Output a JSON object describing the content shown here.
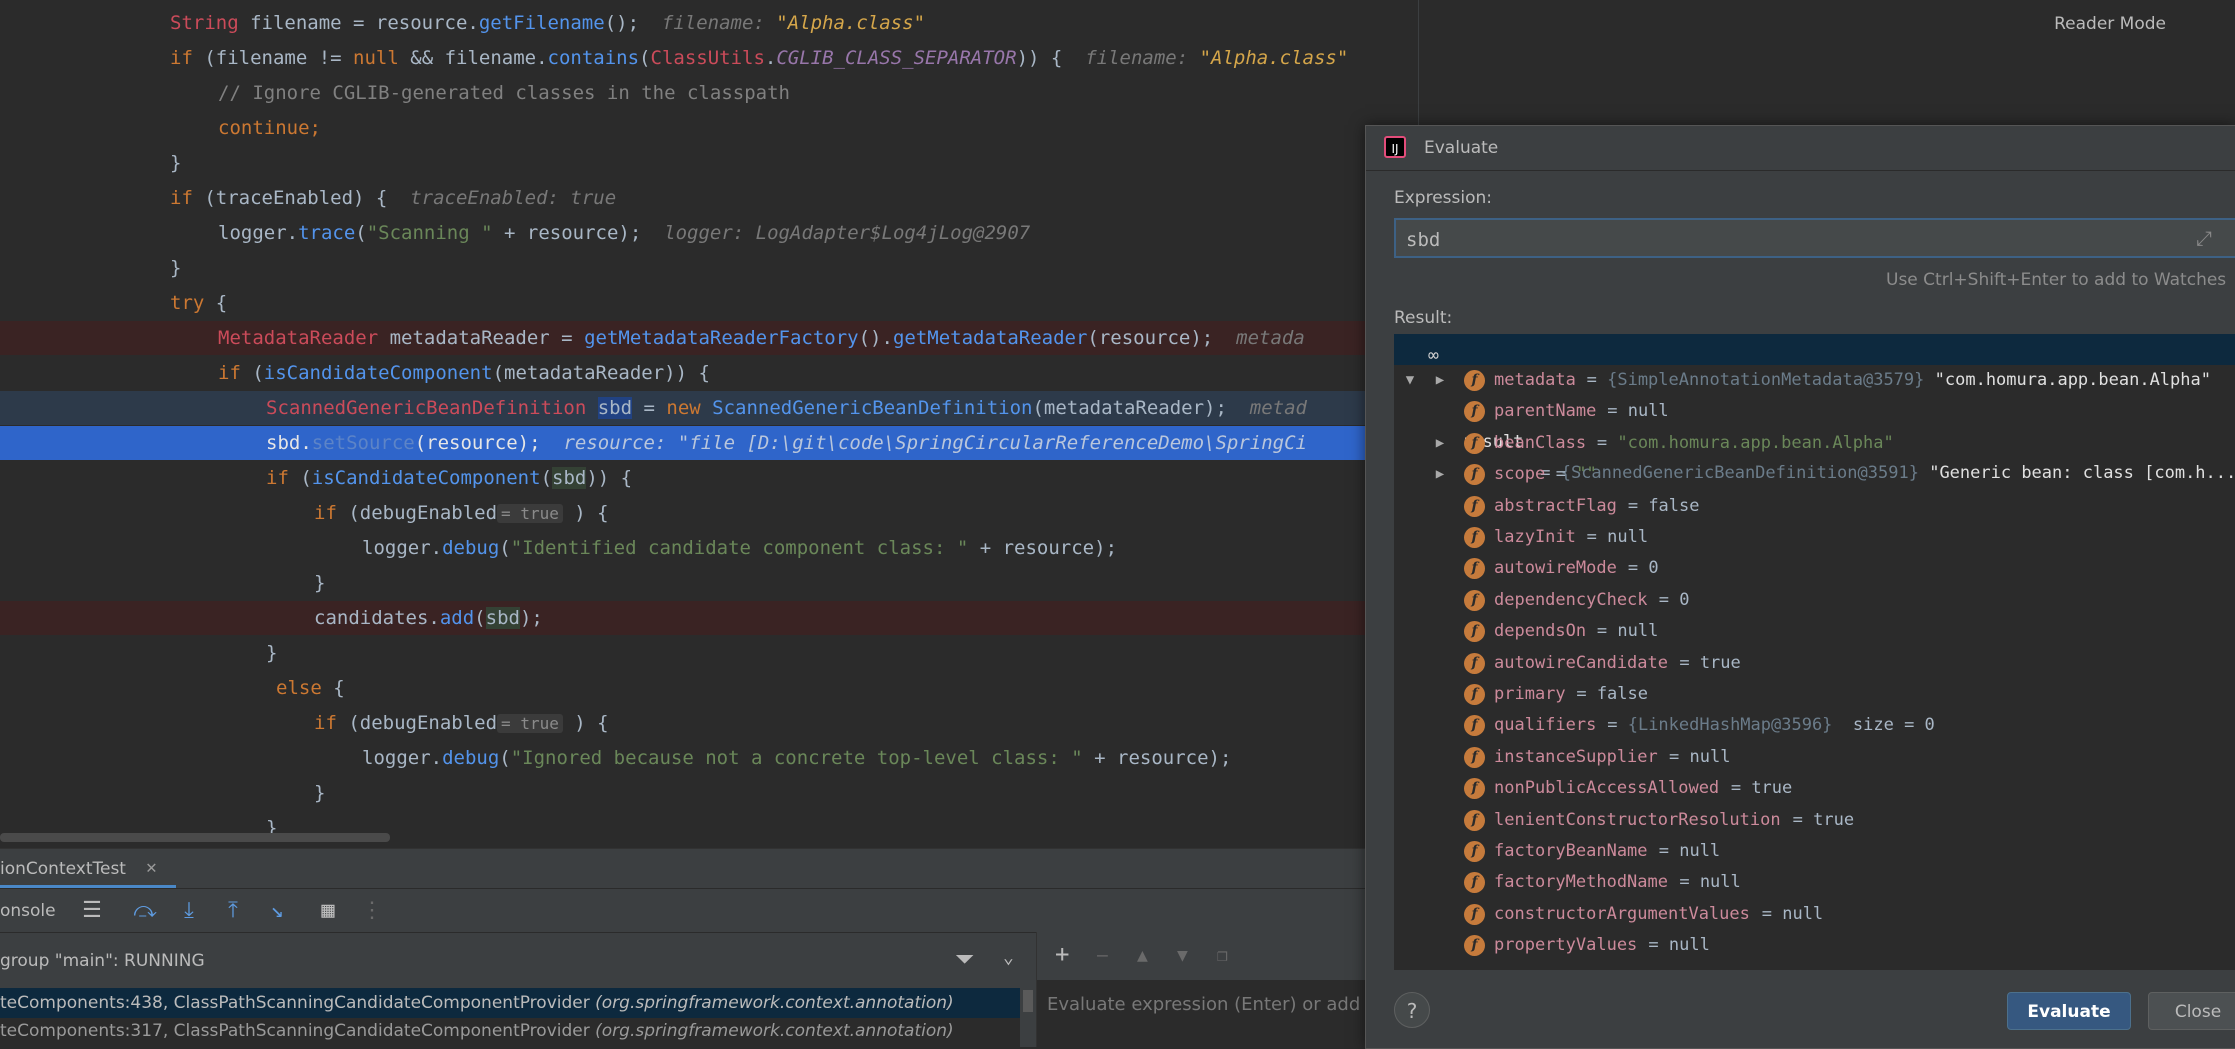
{
  "editor": {
    "lines": [
      [
        "String filename = resource.getFilename();",
        "filename: \"Alpha.class\""
      ],
      [
        "if (filename != null && filename.contains(ClassUtils.CGLIB_CLASS_SEPARATOR)) {",
        "filename: \"Alpha.class\""
      ],
      [
        "// Ignore CGLIB-generated classes in the classpath"
      ],
      [
        "continue;"
      ],
      [
        "}"
      ],
      [
        "if (traceEnabled) {",
        "traceEnabled: true"
      ],
      [
        "logger.trace(\"Scanning \" + resource);",
        "logger: LogAdapter$Log4jLog@2907"
      ],
      [
        "}"
      ],
      [
        "try {"
      ],
      [
        "MetadataReader metadataReader = getMetadataReaderFactory().getMetadataReader(resource);",
        "metada"
      ],
      [
        "if (isCandidateComponent(metadataReader)) {"
      ],
      [
        "ScannedGenericBeanDefinition sbd = new ScannedGenericBeanDefinition(metadataReader);",
        "metad"
      ],
      [
        "sbd.setSource(resource);",
        "resource: \"file [D:\\git\\code\\SpringCircularReferenceDemo\\SpringCi"
      ],
      [
        "if (isCandidateComponent(sbd)) {"
      ],
      [
        "if (debugEnabled",
        "= true",
        ") {"
      ],
      [
        "logger.debug(\"Identified candidate component class: \" + resource);"
      ],
      [
        "}"
      ],
      [
        "candidates.add(sbd);"
      ],
      [
        "}"
      ],
      [
        "else {"
      ],
      [
        "if (debugEnabled",
        "= true",
        ") {"
      ],
      [
        "logger.debug(\"Ignored because not a concrete top-level class: \" + resource);"
      ],
      [
        "}"
      ],
      [
        "}"
      ]
    ]
  },
  "top_right": {
    "reader_mode": "Reader Mode"
  },
  "debug_tab": {
    "label": "ionContextTest",
    "close": "✕"
  },
  "debug_toolbar": {
    "console_label": "onsole",
    "icons": [
      "menu-icon",
      "step-over-icon",
      "step-into-icon",
      "step-out-icon",
      "run-to-cursor-icon",
      "evaluate-icon",
      "trace-icon"
    ]
  },
  "frames": {
    "thread": "group \"main\": RUNNING",
    "rows": [
      {
        "method": "teComponents:438, ClassPathScanningCandidateComponentProvider",
        "pkg": "(org.springframework.context.annotation)",
        "active": true
      },
      {
        "method": "teComponents:317, ClassPathScanningCandidateComponentProvider",
        "pkg": "(org.springframework.context.annotation)",
        "active": false
      }
    ]
  },
  "watches": {
    "placeholder": "Evaluate expression (Enter) or add a watch"
  },
  "dialog": {
    "title": "Evaluate",
    "expression_label": "Expression:",
    "expression_value": "sbd",
    "hint": "Use Ctrl+Shift+Enter to add to Watches",
    "result_label": "Result:",
    "result": {
      "name": "result",
      "object": "{ScannedGenericBeanDefinition@3591}",
      "string": "\"Generic bean: class [com.h... V",
      "fields": [
        {
          "name": "metadata",
          "object": "{SimpleAnnotationMetadata@3579}",
          "value": "\"com.homura.app.bean.Alpha\"",
          "expandable": true
        },
        {
          "name": "parentName",
          "value": "null"
        },
        {
          "name": "beanClass",
          "value": "\"com.homura.app.bean.Alpha\"",
          "expandable": true,
          "green": true
        },
        {
          "name": "scope",
          "value": "\"\"",
          "expandable": true,
          "green": true
        },
        {
          "name": "abstractFlag",
          "value": "false"
        },
        {
          "name": "lazyInit",
          "value": "null"
        },
        {
          "name": "autowireMode",
          "value": "0"
        },
        {
          "name": "dependencyCheck",
          "value": "0"
        },
        {
          "name": "dependsOn",
          "value": "null"
        },
        {
          "name": "autowireCandidate",
          "value": "true"
        },
        {
          "name": "primary",
          "value": "false"
        },
        {
          "name": "qualifiers",
          "object": "{LinkedHashMap@3596}",
          "value": " size = 0"
        },
        {
          "name": "instanceSupplier",
          "value": "null"
        },
        {
          "name": "nonPublicAccessAllowed",
          "value": "true"
        },
        {
          "name": "lenientConstructorResolution",
          "value": "true"
        },
        {
          "name": "factoryBeanName",
          "value": "null"
        },
        {
          "name": "factoryMethodName",
          "value": "null"
        },
        {
          "name": "constructorArgumentValues",
          "value": "null"
        },
        {
          "name": "propertyValues",
          "value": "null"
        }
      ]
    },
    "help": "?",
    "evaluate_button": "Evaluate",
    "close_button": "Close"
  }
}
